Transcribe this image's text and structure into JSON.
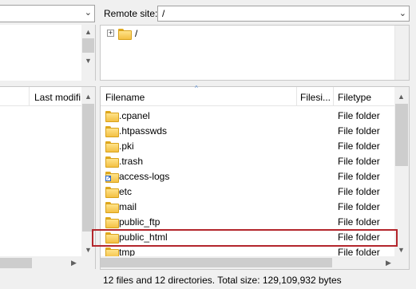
{
  "remote": {
    "site_label": "Remote site:",
    "site_value": "/",
    "tree_root": "/"
  },
  "local": {
    "columns": [
      {
        "label": "Last modifi"
      }
    ]
  },
  "remote_list": {
    "columns": [
      {
        "label": "Filename"
      },
      {
        "label": "Filesi..."
      },
      {
        "label": "Filetype"
      }
    ],
    "rows": [
      {
        "name": ".cpanel",
        "type": "File folder",
        "icon": "folder-icon"
      },
      {
        "name": ".htpasswds",
        "type": "File folder",
        "icon": "folder-icon"
      },
      {
        "name": ".pki",
        "type": "File folder",
        "icon": "folder-icon"
      },
      {
        "name": ".trash",
        "type": "File folder",
        "icon": "folder-icon"
      },
      {
        "name": "access-logs",
        "type": "File folder",
        "icon": "folder-shortcut-icon"
      },
      {
        "name": "etc",
        "type": "File folder",
        "icon": "folder-icon"
      },
      {
        "name": "mail",
        "type": "File folder",
        "icon": "folder-icon"
      },
      {
        "name": "public_ftp",
        "type": "File folder",
        "icon": "folder-icon"
      },
      {
        "name": "public_html",
        "type": "File folder",
        "icon": "folder-icon"
      },
      {
        "name": "tmp",
        "type": "File folder",
        "icon": "folder-icon"
      }
    ]
  },
  "status": {
    "text": "12 files and 12 directories. Total size: 129,109,932 bytes"
  },
  "colors": {
    "highlight": "#b3262c",
    "folder": "#f3c043"
  }
}
